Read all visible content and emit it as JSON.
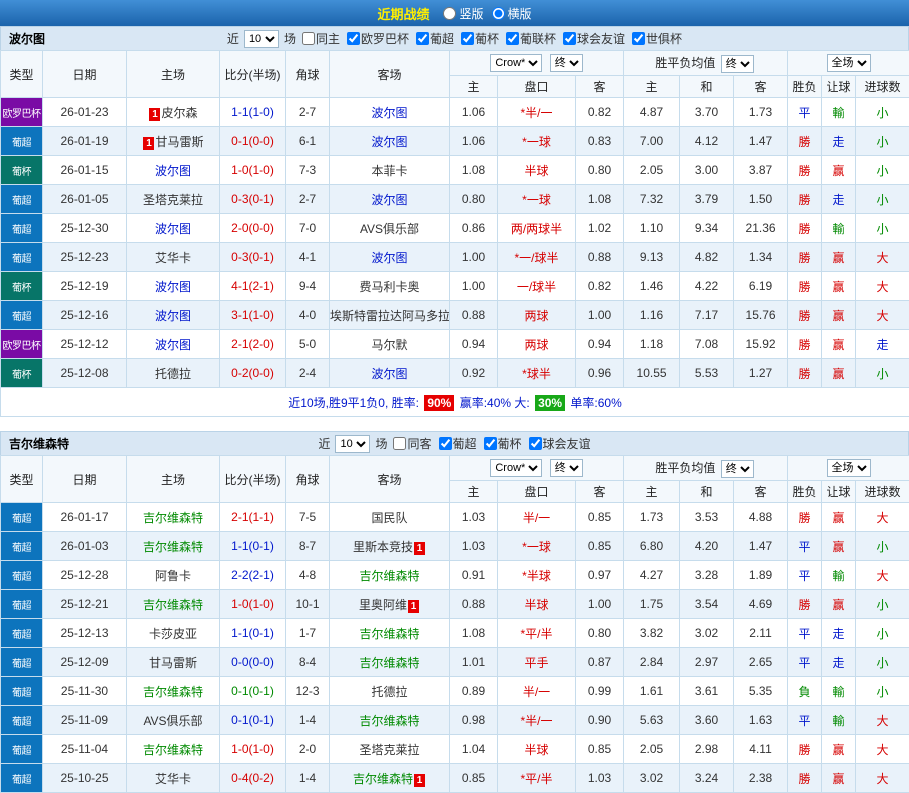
{
  "top_bar": {
    "title": "近期战绩",
    "vertical": "竖版",
    "horizontal": "横版",
    "selected": "横版"
  },
  "table_header": {
    "type": "类型",
    "date": "日期",
    "home": "主场",
    "score": "比分(半场)",
    "corner": "角球",
    "away": "客场",
    "odds_source": "Crow*",
    "final1": "终",
    "wdl": "胜平负均值",
    "final2": "终",
    "fulltime": "全场",
    "sub": [
      "主",
      "盘口",
      "客",
      "主",
      "和",
      "客",
      "胜负",
      "让球",
      "进球数"
    ]
  },
  "colors": {
    "r": "#d60000",
    "b": "#0016cc",
    "g": "#008a00",
    "focal1": "#0016cc",
    "focal2": "#008a00",
    "opp": "#333333",
    "euro": "#7a0ba5",
    "liga": "#0d74bd",
    "cup": "#077568",
    "badge": "#e60000",
    "green_badge": "#18a818"
  },
  "sections": [
    {
      "team": "波尔图",
      "filter": {
        "near": "近",
        "count": "10",
        "games": "场",
        "checkboxes": [
          {
            "label": "同主",
            "checked": false
          },
          {
            "label": "欧罗巴杯",
            "checked": true
          },
          {
            "label": "葡超",
            "checked": true
          },
          {
            "label": "葡杯",
            "checked": true
          },
          {
            "label": "葡联杯",
            "checked": true
          },
          {
            "label": "球会友谊",
            "checked": true
          },
          {
            "label": "世俱杯",
            "checked": true
          }
        ]
      },
      "rows": [
        {
          "type": "欧罗巴杯",
          "tbg": "euro",
          "date": "26-01-23",
          "home": {
            "name": "皮尔森",
            "c": "opp",
            "badge": "1",
            "bpos": "before"
          },
          "score": {
            "t": "1-1(1-0)",
            "c": "b"
          },
          "corner": "2-7",
          "away": {
            "name": "波尔图",
            "c": "focal1"
          },
          "o1": "1.06",
          "hc": "*半/一",
          "o2": "0.82",
          "a1": "4.87",
          "a2": "3.70",
          "a3": "1.73",
          "res": {
            "t": "平",
            "c": "b"
          },
          "let": {
            "t": "輸",
            "c": "g"
          },
          "goal": {
            "t": "小",
            "c": "g"
          }
        },
        {
          "type": "葡超",
          "tbg": "liga",
          "date": "26-01-19",
          "home": {
            "name": "甘马雷斯",
            "c": "opp",
            "badge": "1",
            "bpos": "before"
          },
          "score": {
            "t": "0-1(0-0)",
            "c": "r"
          },
          "corner": "6-1",
          "away": {
            "name": "波尔图",
            "c": "focal1"
          },
          "o1": "1.06",
          "hc": "*一球",
          "o2": "0.83",
          "a1": "7.00",
          "a2": "4.12",
          "a3": "1.47",
          "res": {
            "t": "勝",
            "c": "r"
          },
          "let": {
            "t": "走",
            "c": "b"
          },
          "goal": {
            "t": "小",
            "c": "g"
          }
        },
        {
          "type": "葡杯",
          "tbg": "cup",
          "date": "26-01-15",
          "home": {
            "name": "波尔图",
            "c": "focal1"
          },
          "score": {
            "t": "1-0(1-0)",
            "c": "r"
          },
          "corner": "7-3",
          "away": {
            "name": "本菲卡",
            "c": "opp"
          },
          "o1": "1.08",
          "hc": "半球",
          "o2": "0.80",
          "a1": "2.05",
          "a2": "3.00",
          "a3": "3.87",
          "res": {
            "t": "勝",
            "c": "r"
          },
          "let": {
            "t": "赢",
            "c": "r"
          },
          "goal": {
            "t": "小",
            "c": "g"
          }
        },
        {
          "type": "葡超",
          "tbg": "liga",
          "date": "26-01-05",
          "home": {
            "name": "圣塔克莱拉",
            "c": "opp"
          },
          "score": {
            "t": "0-3(0-1)",
            "c": "r"
          },
          "corner": "2-7",
          "away": {
            "name": "波尔图",
            "c": "focal1"
          },
          "o1": "0.80",
          "hc": "*一球",
          "o2": "1.08",
          "a1": "7.32",
          "a2": "3.79",
          "a3": "1.50",
          "res": {
            "t": "勝",
            "c": "r"
          },
          "let": {
            "t": "走",
            "c": "b"
          },
          "goal": {
            "t": "小",
            "c": "g"
          }
        },
        {
          "type": "葡超",
          "tbg": "liga",
          "date": "25-12-30",
          "home": {
            "name": "波尔图",
            "c": "focal1"
          },
          "score": {
            "t": "2-0(0-0)",
            "c": "r"
          },
          "corner": "7-0",
          "away": {
            "name": "AVS俱乐部",
            "c": "opp"
          },
          "o1": "0.86",
          "hc": "两/两球半",
          "o2": "1.02",
          "a1": "1.10",
          "a2": "9.34",
          "a3": "21.36",
          "res": {
            "t": "勝",
            "c": "r"
          },
          "let": {
            "t": "輸",
            "c": "g"
          },
          "goal": {
            "t": "小",
            "c": "g"
          }
        },
        {
          "type": "葡超",
          "tbg": "liga",
          "date": "25-12-23",
          "home": {
            "name": "艾华卡",
            "c": "opp"
          },
          "score": {
            "t": "0-3(0-1)",
            "c": "r"
          },
          "corner": "4-1",
          "away": {
            "name": "波尔图",
            "c": "focal1"
          },
          "o1": "1.00",
          "hc": "*一/球半",
          "o2": "0.88",
          "a1": "9.13",
          "a2": "4.82",
          "a3": "1.34",
          "res": {
            "t": "勝",
            "c": "r"
          },
          "let": {
            "t": "赢",
            "c": "r"
          },
          "goal": {
            "t": "大",
            "c": "r"
          }
        },
        {
          "type": "葡杯",
          "tbg": "cup",
          "date": "25-12-19",
          "home": {
            "name": "波尔图",
            "c": "focal1"
          },
          "score": {
            "t": "4-1(2-1)",
            "c": "r"
          },
          "corner": "9-4",
          "away": {
            "name": "费马利卡奥",
            "c": "opp"
          },
          "o1": "1.00",
          "hc": "一/球半",
          "o2": "0.82",
          "a1": "1.46",
          "a2": "4.22",
          "a3": "6.19",
          "res": {
            "t": "勝",
            "c": "r"
          },
          "let": {
            "t": "赢",
            "c": "r"
          },
          "goal": {
            "t": "大",
            "c": "r"
          }
        },
        {
          "type": "葡超",
          "tbg": "liga",
          "date": "25-12-16",
          "home": {
            "name": "波尔图",
            "c": "focal1"
          },
          "score": {
            "t": "3-1(1-0)",
            "c": "r"
          },
          "corner": "4-0",
          "away": {
            "name": "埃斯特雷拉达阿马多拉",
            "c": "opp"
          },
          "o1": "0.88",
          "hc": "两球",
          "o2": "1.00",
          "a1": "1.16",
          "a2": "7.17",
          "a3": "15.76",
          "res": {
            "t": "勝",
            "c": "r"
          },
          "let": {
            "t": "赢",
            "c": "r"
          },
          "goal": {
            "t": "大",
            "c": "r"
          }
        },
        {
          "type": "欧罗巴杯",
          "tbg": "euro",
          "date": "25-12-12",
          "home": {
            "name": "波尔图",
            "c": "focal1"
          },
          "score": {
            "t": "2-1(2-0)",
            "c": "r"
          },
          "corner": "5-0",
          "away": {
            "name": "马尔默",
            "c": "opp"
          },
          "o1": "0.94",
          "hc": "两球",
          "o2": "0.94",
          "a1": "1.18",
          "a2": "7.08",
          "a3": "15.92",
          "res": {
            "t": "勝",
            "c": "r"
          },
          "let": {
            "t": "赢",
            "c": "r"
          },
          "goal": {
            "t": "走",
            "c": "b"
          }
        },
        {
          "type": "葡杯",
          "tbg": "cup",
          "date": "25-12-08",
          "home": {
            "name": "托德拉",
            "c": "opp"
          },
          "score": {
            "t": "0-2(0-0)",
            "c": "r"
          },
          "corner": "2-4",
          "away": {
            "name": "波尔图",
            "c": "focal1"
          },
          "o1": "0.92",
          "hc": "*球半",
          "o2": "0.96",
          "a1": "10.55",
          "a2": "5.53",
          "a3": "1.27",
          "res": {
            "t": "勝",
            "c": "r"
          },
          "let": {
            "t": "赢",
            "c": "r"
          },
          "goal": {
            "t": "小",
            "c": "g"
          }
        }
      ],
      "summary": {
        "parts": [
          {
            "text": "近10场,胜9平1负0, 胜率: ",
            "style": "plain"
          },
          {
            "text": "90%",
            "style": "red"
          },
          {
            "text": " 赢率:40%  大: ",
            "style": "plain"
          },
          {
            "text": "30%",
            "style": "green"
          },
          {
            "text": " 单率:60%",
            "style": "plain"
          }
        ]
      }
    },
    {
      "team": "吉尔维森特",
      "filter": {
        "near": "近",
        "count": "10",
        "games": "场",
        "checkboxes": [
          {
            "label": "同客",
            "checked": false
          },
          {
            "label": "葡超",
            "checked": true
          },
          {
            "label": "葡杯",
            "checked": true
          },
          {
            "label": "球会友谊",
            "checked": true
          }
        ]
      },
      "rows": [
        {
          "type": "葡超",
          "tbg": "liga",
          "date": "26-01-17",
          "home": {
            "name": "吉尔维森特",
            "c": "focal2"
          },
          "score": {
            "t": "2-1(1-1)",
            "c": "r"
          },
          "corner": "7-5",
          "away": {
            "name": "国民队",
            "c": "opp"
          },
          "o1": "1.03",
          "hc": "半/一",
          "o2": "0.85",
          "a1": "1.73",
          "a2": "3.53",
          "a3": "4.88",
          "res": {
            "t": "勝",
            "c": "r"
          },
          "let": {
            "t": "赢",
            "c": "r"
          },
          "goal": {
            "t": "大",
            "c": "r"
          }
        },
        {
          "type": "葡超",
          "tbg": "liga",
          "date": "26-01-03",
          "home": {
            "name": "吉尔维森特",
            "c": "focal2"
          },
          "score": {
            "t": "1-1(0-1)",
            "c": "b"
          },
          "corner": "8-7",
          "away": {
            "name": "里斯本竞技",
            "c": "opp",
            "badge": "1",
            "bpos": "after"
          },
          "o1": "1.03",
          "hc": "*一球",
          "o2": "0.85",
          "a1": "6.80",
          "a2": "4.20",
          "a3": "1.47",
          "res": {
            "t": "平",
            "c": "b"
          },
          "let": {
            "t": "赢",
            "c": "r"
          },
          "goal": {
            "t": "小",
            "c": "g"
          }
        },
        {
          "type": "葡超",
          "tbg": "liga",
          "date": "25-12-28",
          "home": {
            "name": "阿鲁卡",
            "c": "opp"
          },
          "score": {
            "t": "2-2(2-1)",
            "c": "b"
          },
          "corner": "4-8",
          "away": {
            "name": "吉尔维森特",
            "c": "focal2"
          },
          "o1": "0.91",
          "hc": "*半球",
          "o2": "0.97",
          "a1": "4.27",
          "a2": "3.28",
          "a3": "1.89",
          "res": {
            "t": "平",
            "c": "b"
          },
          "let": {
            "t": "輸",
            "c": "g"
          },
          "goal": {
            "t": "大",
            "c": "r"
          }
        },
        {
          "type": "葡超",
          "tbg": "liga",
          "date": "25-12-21",
          "home": {
            "name": "吉尔维森特",
            "c": "focal2"
          },
          "score": {
            "t": "1-0(1-0)",
            "c": "r"
          },
          "corner": "10-1",
          "away": {
            "name": "里奥阿维",
            "c": "opp",
            "badge": "1",
            "bpos": "after"
          },
          "o1": "0.88",
          "hc": "半球",
          "o2": "1.00",
          "a1": "1.75",
          "a2": "3.54",
          "a3": "4.69",
          "res": {
            "t": "勝",
            "c": "r"
          },
          "let": {
            "t": "赢",
            "c": "r"
          },
          "goal": {
            "t": "小",
            "c": "g"
          }
        },
        {
          "type": "葡超",
          "tbg": "liga",
          "date": "25-12-13",
          "home": {
            "name": "卡莎皮亚",
            "c": "opp"
          },
          "score": {
            "t": "1-1(0-1)",
            "c": "b"
          },
          "corner": "1-7",
          "away": {
            "name": "吉尔维森特",
            "c": "focal2"
          },
          "o1": "1.08",
          "hc": "*平/半",
          "o2": "0.80",
          "a1": "3.82",
          "a2": "3.02",
          "a3": "2.11",
          "res": {
            "t": "平",
            "c": "b"
          },
          "let": {
            "t": "走",
            "c": "b"
          },
          "goal": {
            "t": "小",
            "c": "g"
          }
        },
        {
          "type": "葡超",
          "tbg": "liga",
          "date": "25-12-09",
          "home": {
            "name": "甘马雷斯",
            "c": "opp"
          },
          "score": {
            "t": "0-0(0-0)",
            "c": "b"
          },
          "corner": "8-4",
          "away": {
            "name": "吉尔维森特",
            "c": "focal2"
          },
          "o1": "1.01",
          "hc": "平手",
          "o2": "0.87",
          "a1": "2.84",
          "a2": "2.97",
          "a3": "2.65",
          "res": {
            "t": "平",
            "c": "b"
          },
          "let": {
            "t": "走",
            "c": "b"
          },
          "goal": {
            "t": "小",
            "c": "g"
          }
        },
        {
          "type": "葡超",
          "tbg": "liga",
          "date": "25-11-30",
          "home": {
            "name": "吉尔维森特",
            "c": "focal2"
          },
          "score": {
            "t": "0-1(0-1)",
            "c": "g"
          },
          "corner": "12-3",
          "away": {
            "name": "托德拉",
            "c": "opp"
          },
          "o1": "0.89",
          "hc": "半/一",
          "o2": "0.99",
          "a1": "1.61",
          "a2": "3.61",
          "a3": "5.35",
          "res": {
            "t": "負",
            "c": "g"
          },
          "let": {
            "t": "輸",
            "c": "g"
          },
          "goal": {
            "t": "小",
            "c": "g"
          }
        },
        {
          "type": "葡超",
          "tbg": "liga",
          "date": "25-11-09",
          "home": {
            "name": "AVS俱乐部",
            "c": "opp"
          },
          "score": {
            "t": "0-1(0-1)",
            "c": "b"
          },
          "corner": "1-4",
          "away": {
            "name": "吉尔维森特",
            "c": "focal2"
          },
          "o1": "0.98",
          "hc": "*半/一",
          "o2": "0.90",
          "a1": "5.63",
          "a2": "3.60",
          "a3": "1.63",
          "res": {
            "t": "平",
            "c": "b"
          },
          "let": {
            "t": "輸",
            "c": "g"
          },
          "goal": {
            "t": "大",
            "c": "r"
          }
        },
        {
          "type": "葡超",
          "tbg": "liga",
          "date": "25-11-04",
          "home": {
            "name": "吉尔维森特",
            "c": "focal2"
          },
          "score": {
            "t": "1-0(1-0)",
            "c": "r"
          },
          "corner": "2-0",
          "away": {
            "name": "圣塔克莱拉",
            "c": "opp"
          },
          "o1": "1.04",
          "hc": "半球",
          "o2": "0.85",
          "a1": "2.05",
          "a2": "2.98",
          "a3": "4.11",
          "res": {
            "t": "勝",
            "c": "r"
          },
          "let": {
            "t": "赢",
            "c": "r"
          },
          "goal": {
            "t": "大",
            "c": "r"
          }
        },
        {
          "type": "葡超",
          "tbg": "liga",
          "date": "25-10-25",
          "home": {
            "name": "艾华卡",
            "c": "opp"
          },
          "score": {
            "t": "0-4(0-2)",
            "c": "r"
          },
          "corner": "1-4",
          "away": {
            "name": "吉尔维森特",
            "c": "focal2",
            "badge": "1",
            "bpos": "after"
          },
          "o1": "0.85",
          "hc": "*平/半",
          "o2": "1.03",
          "a1": "3.02",
          "a2": "3.24",
          "a3": "2.38",
          "res": {
            "t": "勝",
            "c": "r"
          },
          "let": {
            "t": "赢",
            "c": "r"
          },
          "goal": {
            "t": "大",
            "c": "r"
          }
        }
      ]
    }
  ]
}
